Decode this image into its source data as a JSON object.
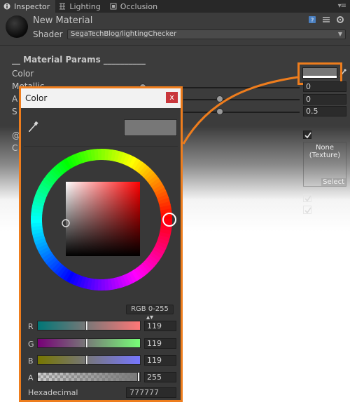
{
  "tabs": [
    {
      "label": "Inspector",
      "icon": "info-icon",
      "active": true
    },
    {
      "label": "Lighting",
      "icon": "lighting-icon",
      "active": false
    },
    {
      "label": "Occlusion",
      "icon": "occlusion-icon",
      "active": false
    }
  ],
  "header": {
    "material_name": "New Material",
    "shader_label": "Shader",
    "shader_value": "SegaTechBlog/lightingChecker"
  },
  "params": {
    "section_title": "__ Material Params __________",
    "color_label": "Color",
    "color_value": "#777777",
    "rows": [
      {
        "label": "Metallic",
        "value": "0",
        "level": 0.45
      },
      {
        "label": "A",
        "value": "0",
        "level": 0.7
      },
      {
        "label": "S",
        "value": "0.5",
        "level": 0.7
      }
    ],
    "toggle_label": "@",
    "texture_label": "C",
    "texture_none": "None",
    "texture_type": "(Texture)",
    "texture_select": "Select"
  },
  "color_popup": {
    "title": "Color",
    "close": "x",
    "mode": "RGB 0-255",
    "channels": [
      {
        "label": "R",
        "value": "119"
      },
      {
        "label": "G",
        "value": "119"
      },
      {
        "label": "B",
        "value": "119"
      },
      {
        "label": "A",
        "value": "255"
      }
    ],
    "hex_label": "Hexadecimal",
    "hex_value": "777777"
  },
  "colors": {
    "accent_orange": "#ee7d1d",
    "swatch": "#777777",
    "close_red": "#c9373c"
  }
}
